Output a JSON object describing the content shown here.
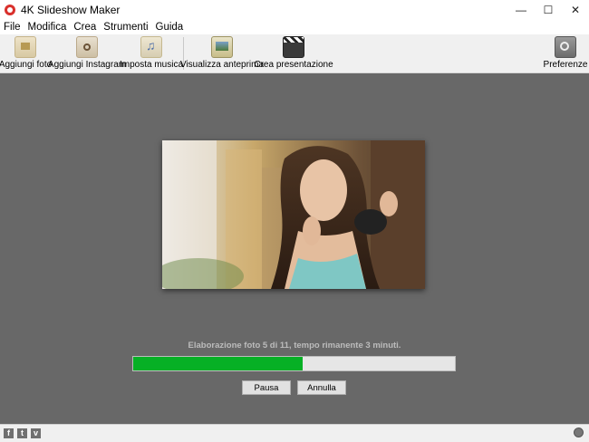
{
  "window": {
    "title": "4K Slideshow Maker",
    "controls": {
      "minimize": "—",
      "maximize": "☐",
      "close": "✕"
    }
  },
  "menu": [
    "File",
    "Modifica",
    "Crea",
    "Strumenti",
    "Guida"
  ],
  "toolbar": {
    "add_photo": "Aggiungi foto",
    "add_instagram": "Aggiungi Instagram",
    "set_music": "Imposta musica",
    "preview": "Visualizza anteprima",
    "create_presentation": "Crea presentazione",
    "preferences": "Preferenze"
  },
  "progress": {
    "status": "Elaborazione foto 5 di 11, tempo rimanente 3 minuti.",
    "fraction": 0.527,
    "color": "#06b025"
  },
  "actions": {
    "pause": "Pausa",
    "cancel": "Annulla"
  },
  "footer": {
    "social": {
      "facebook": "f",
      "twitter": "t",
      "vimeo": "v"
    }
  }
}
